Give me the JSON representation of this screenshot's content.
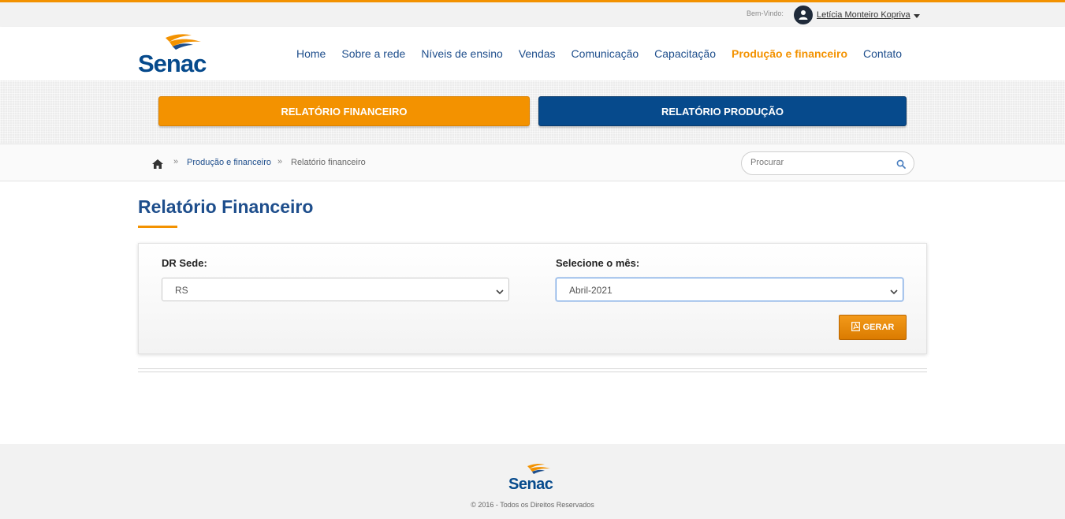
{
  "topbar": {
    "welcome": "Bem-Vindo:",
    "user_name": "Letícia Monteiro Kopriva"
  },
  "header": {
    "logo_text": "Senac",
    "nav": [
      {
        "label": "Home"
      },
      {
        "label": "Sobre a rede"
      },
      {
        "label": "Níveis de ensino"
      },
      {
        "label": "Vendas"
      },
      {
        "label": "Comunicação"
      },
      {
        "label": "Capacitação"
      },
      {
        "label": "Produção e financeiro",
        "active": true
      },
      {
        "label": "Contato"
      }
    ]
  },
  "tabs": {
    "financeiro": "RELATÓRIO FINANCEIRO",
    "producao": "RELATÓRIO PRODUÇÃO"
  },
  "breadcrumb": {
    "items": [
      "Produção e financeiro",
      "Relatório financeiro"
    ],
    "separator": "»"
  },
  "search": {
    "placeholder": "Procurar"
  },
  "main": {
    "title": "Relatório Financeiro",
    "form": {
      "dr_label": "DR Sede:",
      "dr_value": "RS",
      "month_label": "Selecione o mês:",
      "month_value": "Abril-2021",
      "submit_label": "GERAR"
    }
  },
  "footer": {
    "copyright": "© 2016 - Todos os Direitos Reservados"
  },
  "colors": {
    "accent": "#f39200",
    "brand": "#064a8c",
    "link": "#1e4e8c"
  }
}
